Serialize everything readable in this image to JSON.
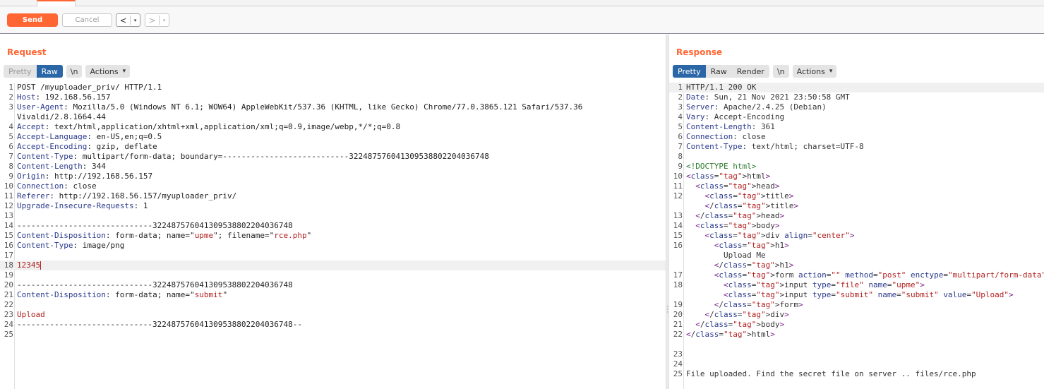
{
  "toolbar": {
    "send_label": "Send",
    "cancel_label": "Cancel",
    "back_glyph": "<",
    "forward_glyph": ">",
    "dropdown_glyph": "▾"
  },
  "request": {
    "title": "Request",
    "view_modes": [
      "Pretty",
      "Raw"
    ],
    "active_view": "Raw",
    "newline_toggle": "\\n",
    "actions_label": "Actions",
    "lines": [
      {
        "n": "1",
        "key": "",
        "val": "POST /myuploader_priv/ HTTP/1.1"
      },
      {
        "n": "2",
        "key": "Host",
        "val": ": 192.168.56.157"
      },
      {
        "n": "3",
        "key": "User-Agent",
        "val": ": Mozilla/5.0 (Windows NT 6.1; WOW64) AppleWebKit/537.36 (KHTML, like Gecko) Chrome/77.0.3865.121 Safari/537.36"
      },
      {
        "n": "",
        "key": "",
        "val": "Vivaldi/2.8.1664.44"
      },
      {
        "n": "4",
        "key": "Accept",
        "val": ": text/html,application/xhtml+xml,application/xml;q=0.9,image/webp,*/*;q=0.8"
      },
      {
        "n": "5",
        "key": "Accept-Language",
        "val": ": en-US,en;q=0.5"
      },
      {
        "n": "6",
        "key": "Accept-Encoding",
        "val": ": gzip, deflate"
      },
      {
        "n": "7",
        "key": "Content-Type",
        "val": ": multipart/form-data; boundary=---------------------------322487576041309538802204036748"
      },
      {
        "n": "8",
        "key": "Content-Length",
        "val": ": 344"
      },
      {
        "n": "9",
        "key": "Origin",
        "val": ": http://192.168.56.157"
      },
      {
        "n": "10",
        "key": "Connection",
        "val": ": close"
      },
      {
        "n": "11",
        "key": "Referer",
        "val": ": http://192.168.56.157/myuploader_priv/"
      },
      {
        "n": "12",
        "key": "Upgrade-Insecure-Requests",
        "val": ": 1"
      },
      {
        "n": "13",
        "key": "",
        "val": ""
      },
      {
        "n": "14",
        "key": "",
        "val": "-----------------------------322487576041309538802204036748"
      },
      {
        "n": "15",
        "key": "Content-Disposition",
        "val": ": form-data; name=\"upme\"; filename=\"rce.php\""
      },
      {
        "n": "16",
        "key": "Content-Type",
        "val": ": image/png"
      },
      {
        "n": "17",
        "key": "",
        "val": ""
      },
      {
        "n": "18",
        "key": "",
        "val": "12345"
      },
      {
        "n": "19",
        "key": "",
        "val": ""
      },
      {
        "n": "20",
        "key": "",
        "val": "-----------------------------322487576041309538802204036748"
      },
      {
        "n": "21",
        "key": "Content-Disposition",
        "val": ": form-data; name=\"submit\""
      },
      {
        "n": "22",
        "key": "",
        "val": ""
      },
      {
        "n": "23",
        "key": "",
        "val": "Upload"
      },
      {
        "n": "24",
        "key": "",
        "val": "-----------------------------322487576041309538802204036748--"
      },
      {
        "n": "25",
        "key": "",
        "val": ""
      }
    ]
  },
  "response": {
    "title": "Response",
    "view_modes": [
      "Pretty",
      "Raw",
      "Render"
    ],
    "active_view": "Pretty",
    "newline_toggle": "\\n",
    "actions_label": "Actions",
    "lines": [
      {
        "n": "1",
        "text": "HTTP/1.1 200 OK"
      },
      {
        "n": "2",
        "text": "Date: Sun, 21 Nov 2021 23:50:58 GMT"
      },
      {
        "n": "3",
        "text": "Server: Apache/2.4.25 (Debian)"
      },
      {
        "n": "4",
        "text": "Vary: Accept-Encoding"
      },
      {
        "n": "5",
        "text": "Content-Length: 361"
      },
      {
        "n": "6",
        "text": "Connection: close"
      },
      {
        "n": "7",
        "text": "Content-Type: text/html; charset=UTF-8"
      },
      {
        "n": "8",
        "text": ""
      },
      {
        "n": "9",
        "text": "<!DOCTYPE html>"
      },
      {
        "n": "10",
        "text": "<html>"
      },
      {
        "n": "11",
        "text": "  <head>"
      },
      {
        "n": "12",
        "text": "    <title>"
      },
      {
        "n": "",
        "text": "    </title>"
      },
      {
        "n": "13",
        "text": "  </head>"
      },
      {
        "n": "14",
        "text": "  <body>"
      },
      {
        "n": "15",
        "text": "    <div align=\"center\">"
      },
      {
        "n": "16",
        "text": "      <h1>"
      },
      {
        "n": "",
        "text": "        Upload Me"
      },
      {
        "n": "",
        "text": "      </h1>"
      },
      {
        "n": "17",
        "text": "      <form action=\"\" method=\"post\" enctype=\"multipart/form-data\">"
      },
      {
        "n": "18",
        "text": "        <input type=\"file\" name=\"upme\">"
      },
      {
        "n": "",
        "text": "        <input type=\"submit\" name=\"submit\" value=\"Upload\">"
      },
      {
        "n": "19",
        "text": "      </form>"
      },
      {
        "n": "20",
        "text": "    </div>"
      },
      {
        "n": "21",
        "text": "  </body>"
      },
      {
        "n": "22",
        "text": "</html>"
      },
      {
        "n": "",
        "text": ""
      },
      {
        "n": "23",
        "text": ""
      },
      {
        "n": "24",
        "text": ""
      },
      {
        "n": "25",
        "text": "File uploaded. Find the secret file on server .. files/rce.php"
      }
    ]
  },
  "colors": {
    "accent": "#ff6633",
    "active_toggle": "#2b67a6"
  }
}
